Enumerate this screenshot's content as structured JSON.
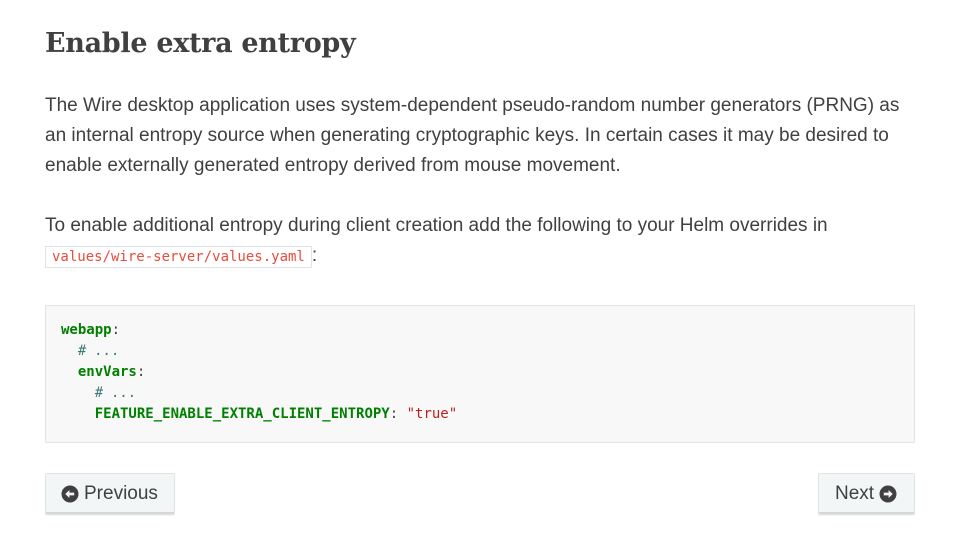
{
  "page": {
    "title": "Enable extra entropy",
    "paragraph1": "The Wire desktop application uses system-dependent pseudo-random number generators (PRNG) as an internal entropy source when generating cryptographic keys. In certain cases it may be desired to enable externally generated entropy derived from mouse movement.",
    "paragraph2_text": "To enable additional entropy during client creation add the following to your Helm overrides in",
    "paragraph2_code": "values/wire-server/values.yaml",
    "paragraph2_suffix": ":"
  },
  "code_block": {
    "line1_key": "webapp",
    "line1_colon": ":",
    "line2_comment": "# ...",
    "line3_key": "envVars",
    "line3_colon": ":",
    "line4_comment": "# ...",
    "line5_key": "FEATURE_ENABLE_EXTRA_CLIENT_ENTROPY",
    "line5_colon": ": ",
    "line5_value": "\"true\""
  },
  "navigation": {
    "previous_label": "Previous",
    "next_label": "Next",
    "previous_icon": "arrow-circle-left-icon",
    "next_icon": "arrow-circle-right-icon"
  },
  "colors": {
    "text": "#404040",
    "inline_code": "#e74c3c",
    "yaml_key": "#008000",
    "yaml_comment": "#3d7b7b",
    "yaml_string": "#ba2121",
    "code_bg": "#f8f8f8"
  }
}
